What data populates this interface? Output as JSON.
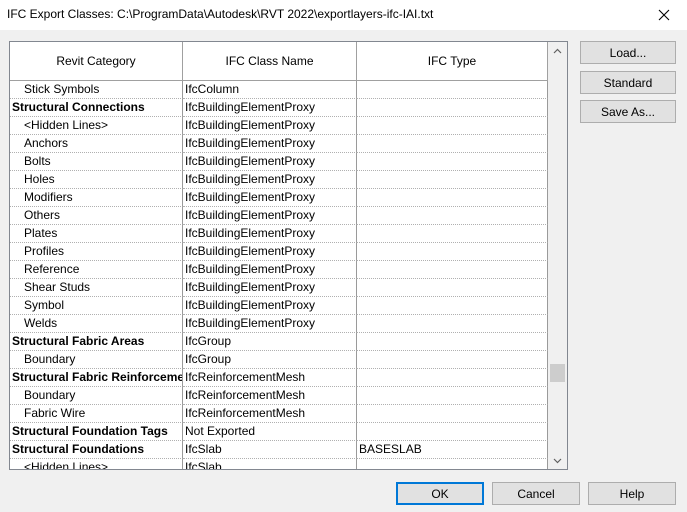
{
  "window": {
    "title": "IFC Export Classes: C:\\ProgramData\\Autodesk\\RVT 2022\\exportlayers-ifc-IAI.txt"
  },
  "table": {
    "headers": [
      "Revit Category",
      "IFC Class Name",
      "IFC Type"
    ],
    "rows": [
      {
        "category": "Stick Symbols",
        "ifc_class": "IfcColumn",
        "ifc_type": "",
        "level": "child"
      },
      {
        "category": "Structural Connections",
        "ifc_class": "IfcBuildingElementProxy",
        "ifc_type": "",
        "level": "parent"
      },
      {
        "category": "<Hidden Lines>",
        "ifc_class": "IfcBuildingElementProxy",
        "ifc_type": "",
        "level": "child"
      },
      {
        "category": "Anchors",
        "ifc_class": "IfcBuildingElementProxy",
        "ifc_type": "",
        "level": "child"
      },
      {
        "category": "Bolts",
        "ifc_class": "IfcBuildingElementProxy",
        "ifc_type": "",
        "level": "child"
      },
      {
        "category": "Holes",
        "ifc_class": "IfcBuildingElementProxy",
        "ifc_type": "",
        "level": "child"
      },
      {
        "category": "Modifiers",
        "ifc_class": "IfcBuildingElementProxy",
        "ifc_type": "",
        "level": "child"
      },
      {
        "category": "Others",
        "ifc_class": "IfcBuildingElementProxy",
        "ifc_type": "",
        "level": "child"
      },
      {
        "category": "Plates",
        "ifc_class": "IfcBuildingElementProxy",
        "ifc_type": "",
        "level": "child"
      },
      {
        "category": "Profiles",
        "ifc_class": "IfcBuildingElementProxy",
        "ifc_type": "",
        "level": "child"
      },
      {
        "category": "Reference",
        "ifc_class": "IfcBuildingElementProxy",
        "ifc_type": "",
        "level": "child"
      },
      {
        "category": "Shear Studs",
        "ifc_class": "IfcBuildingElementProxy",
        "ifc_type": "",
        "level": "child"
      },
      {
        "category": "Symbol",
        "ifc_class": "IfcBuildingElementProxy",
        "ifc_type": "",
        "level": "child"
      },
      {
        "category": "Welds",
        "ifc_class": "IfcBuildingElementProxy",
        "ifc_type": "",
        "level": "child"
      },
      {
        "category": "Structural Fabric Areas",
        "ifc_class": "IfcGroup",
        "ifc_type": "",
        "level": "parent"
      },
      {
        "category": "Boundary",
        "ifc_class": "IfcGroup",
        "ifc_type": "",
        "level": "child"
      },
      {
        "category": "Structural Fabric Reinforceme",
        "ifc_class": "IfcReinforcementMesh",
        "ifc_type": "",
        "level": "parent"
      },
      {
        "category": "Boundary",
        "ifc_class": "IfcReinforcementMesh",
        "ifc_type": "",
        "level": "child"
      },
      {
        "category": "Fabric Wire",
        "ifc_class": "IfcReinforcementMesh",
        "ifc_type": "",
        "level": "child"
      },
      {
        "category": "Structural Foundation Tags",
        "ifc_class": "Not Exported",
        "ifc_type": "",
        "level": "parent"
      },
      {
        "category": "Structural Foundations",
        "ifc_class": "IfcSlab",
        "ifc_type": "BASESLAB",
        "level": "parent"
      },
      {
        "category": "<Hidden Lines>",
        "ifc_class": "IfcSlab",
        "ifc_type": "",
        "level": "child"
      }
    ]
  },
  "side_buttons": {
    "load": "Load...",
    "standard": "Standard",
    "save_as": "Save As..."
  },
  "footer_buttons": {
    "ok": "OK",
    "cancel": "Cancel",
    "help": "Help"
  },
  "icons": {
    "close": "close-icon",
    "scroll_up": "chevron-up-icon",
    "scroll_down": "chevron-down-icon"
  },
  "colors": {
    "default_button_border": "#0078d7",
    "grid_border": "#828790"
  }
}
